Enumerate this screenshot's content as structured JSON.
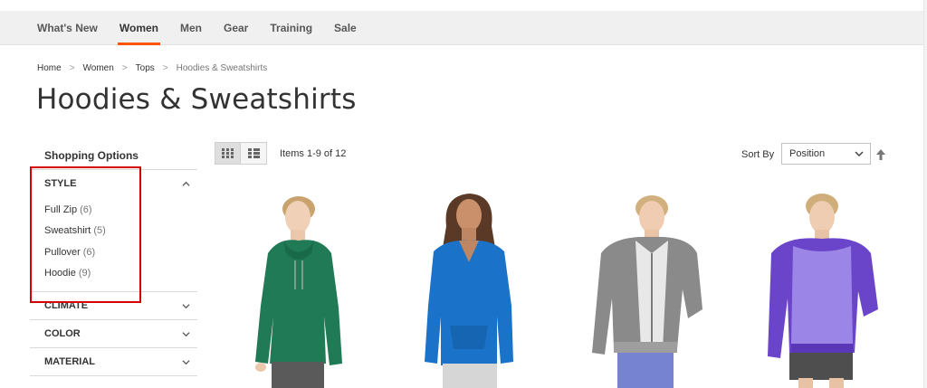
{
  "nav": {
    "items": [
      {
        "label": "What's New",
        "active": false
      },
      {
        "label": "Women",
        "active": true
      },
      {
        "label": "Men",
        "active": false
      },
      {
        "label": "Gear",
        "active": false
      },
      {
        "label": "Training",
        "active": false
      },
      {
        "label": "Sale",
        "active": false
      }
    ],
    "accent_color": "#ff5501"
  },
  "breadcrumb": {
    "items": [
      "Home",
      "Women",
      "Tops"
    ],
    "current": "Hoodies & Sweatshirts",
    "separator": ">"
  },
  "page": {
    "title": "Hoodies & Sweatshirts"
  },
  "sidebar": {
    "title": "Shopping Options",
    "filters": [
      {
        "name": "STYLE",
        "expanded": true,
        "items": [
          {
            "label": "Full Zip",
            "count": "(6)"
          },
          {
            "label": "Sweatshirt",
            "count": "(5)"
          },
          {
            "label": "Pullover",
            "count": "(6)"
          },
          {
            "label": "Hoodie",
            "count": "(9)"
          }
        ]
      },
      {
        "name": "CLIMATE",
        "expanded": false
      },
      {
        "name": "COLOR",
        "expanded": false
      },
      {
        "name": "MATERIAL",
        "expanded": false
      }
    ],
    "highlight_color": "#d40000"
  },
  "toolbar": {
    "modes": [
      {
        "icon": "grid-view-icon",
        "active": true
      },
      {
        "icon": "list-view-icon",
        "active": false
      }
    ],
    "amount": "Items 1-9 of 12",
    "sort_label": "Sort By",
    "sort_value": "Position",
    "sort_direction_icon": "arrow-up-icon"
  },
  "products": [
    {
      "image": "woman-green-hoodie",
      "top_color": "#1f7a55"
    },
    {
      "image": "woman-blue-hoodie",
      "top_color": "#1a72c9"
    },
    {
      "image": "woman-gray-zip-hoodie",
      "top_color": "#8a8a8a"
    },
    {
      "image": "woman-purple-raglan-hoodie",
      "top_color": "#9b86e8"
    }
  ]
}
